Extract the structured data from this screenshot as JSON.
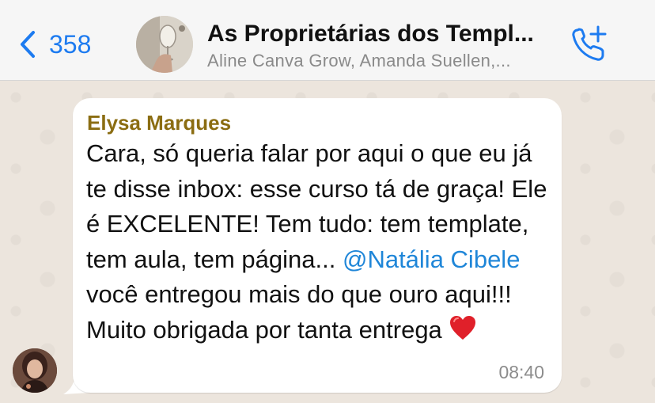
{
  "header": {
    "back_count": "358",
    "group_title": "As Proprietárias dos Templ...",
    "participants": "Aline Canva Grow, Amanda Suellen,..."
  },
  "message": {
    "sender": "Elysa Marques",
    "text_before_mention": "Cara, só queria falar por aqui o que eu já te disse inbox: esse curso tá de graça! Ele é EXCELENTE! Tem tudo: tem template, tem aula, tem página...",
    "mention": "@Natália Cibele",
    "text_after_mention": " você entregou mais do que ouro aqui!!! Muito obrigada por tanta entrega ",
    "time": "08:40"
  },
  "icons": {
    "back": "chevron-left-icon",
    "call": "phone-plus-icon",
    "heart": "red-heart-emoji"
  },
  "colors": {
    "accent": "#1d7bf0",
    "sender_name": "#8b6d12",
    "mention": "#1f86d8",
    "wallpaper": "#ece5dd",
    "header_bg": "#f6f6f6"
  }
}
